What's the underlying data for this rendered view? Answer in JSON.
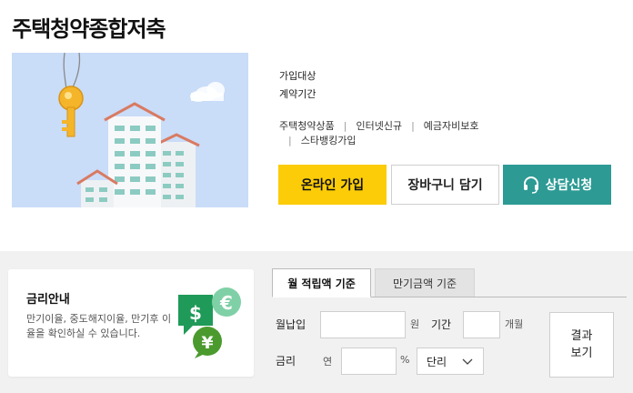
{
  "header": {
    "title": "주택청약종합저축"
  },
  "info": {
    "target_label": "가입대상",
    "period_label": "계약기간",
    "tags": [
      "주택청약상품",
      "인터넷신규",
      "예금자비보호",
      "스타뱅킹가입"
    ]
  },
  "actions": {
    "join_label": "온라인 가입",
    "cart_label": "장바구니 담기",
    "consult_label": "상담신청"
  },
  "rate_info": {
    "title": "금리안내",
    "description": "만기이율, 중도해지이율, 만기후 이율을 확인하실 수 있습니다."
  },
  "calculator": {
    "tabs": [
      {
        "label": "월 적립액 기준",
        "active": true
      },
      {
        "label": "만기금액 기준",
        "active": false
      }
    ],
    "monthly_label": "월납입",
    "monthly_value": "",
    "monthly_unit": "원",
    "period_label": "기간",
    "period_value": "",
    "period_unit": "개월",
    "rate_label": "금리",
    "rate_prefix": "연",
    "rate_value": "",
    "rate_unit": "%",
    "interest_type": "단리",
    "result_label": "결과\n보기"
  },
  "colors": {
    "join": "#fccc08",
    "consult": "#2d9a94",
    "banner_bg": "#c9dcf8"
  },
  "icons": {
    "consult": "headset-icon",
    "currency": "currency-coins-icon",
    "dropdown": "chevron-down-icon"
  }
}
